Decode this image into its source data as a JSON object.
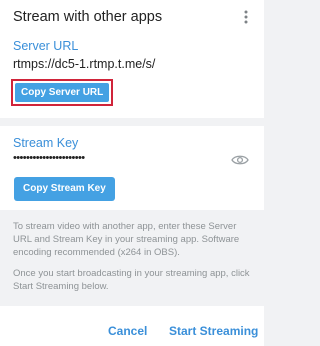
{
  "dialog": {
    "title": "Stream with other apps",
    "menu_icon": "vertical-dots-icon"
  },
  "server": {
    "label": "Server URL",
    "value": "rtmps://dc5-1.rtmp.t.me/s/",
    "copy_button": "Copy Server URL"
  },
  "key": {
    "label": "Stream Key",
    "value": "••••••••••••••••••••••",
    "reveal_icon": "eye-icon",
    "copy_button": "Copy Stream Key"
  },
  "info": {
    "paragraph1": "To stream video with another app, enter these Server URL and Stream Key in your streaming app. Software encoding recommended (x264 in OBS).",
    "paragraph2": "Once you start broadcasting in your streaming app, click Start Streaming below."
  },
  "footer": {
    "cancel_label": "Cancel",
    "start_label": "Start Streaming"
  },
  "colors": {
    "accent": "#3a8fd9",
    "button": "#44a1e3",
    "highlight_border": "#d0243a",
    "info_text": "#8e9396"
  }
}
